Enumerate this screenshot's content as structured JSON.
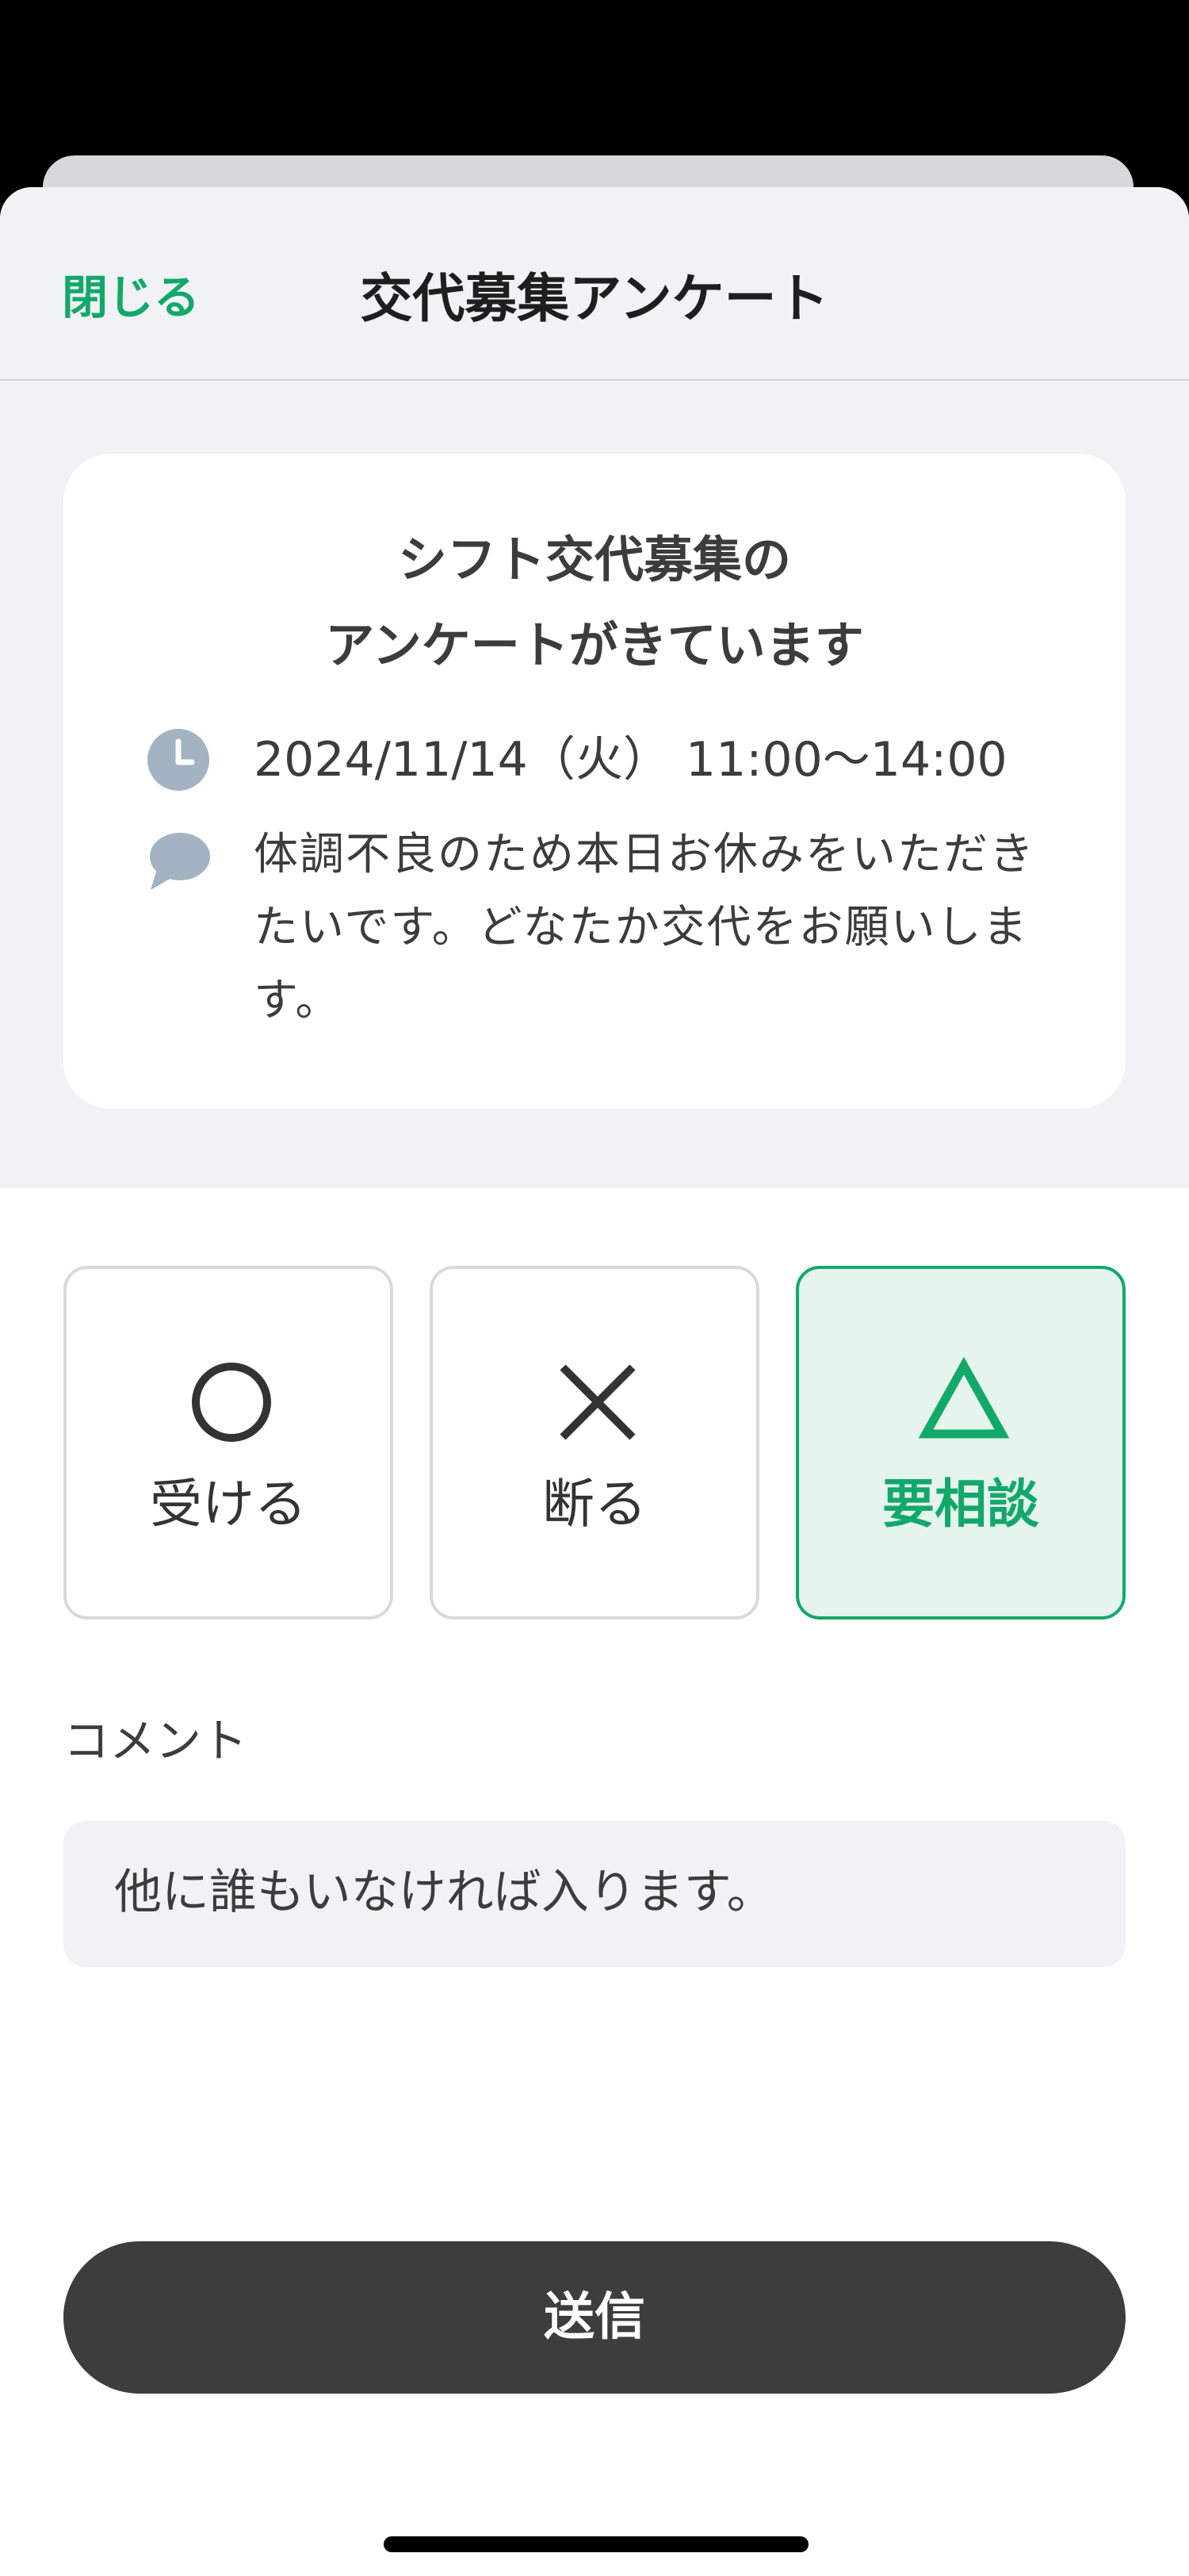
{
  "nav": {
    "close_label": "閉じる",
    "title": "交代募集アンケート"
  },
  "card": {
    "title_line1": "シフト交代募集の",
    "title_line2": "アンケートがきています",
    "date": "2024/11/14（火）  11:00〜14:00",
    "message": "体調不良のため本日お休みをいただきたいです。どなたか交代をお願いします。",
    "icons": {
      "date": "clock-icon",
      "message": "speech-bubble-icon"
    }
  },
  "choices": [
    {
      "symbol": "circle",
      "label": "受ける",
      "selected": false
    },
    {
      "symbol": "cross",
      "label": "断る",
      "selected": false
    },
    {
      "symbol": "triangle",
      "label": "要相談",
      "selected": true
    }
  ],
  "comment": {
    "label": "コメント",
    "value": "他に誰もいなければ入ります。"
  },
  "submit": {
    "label": "送信"
  },
  "colors": {
    "accent": "#12a86a",
    "accent_bg": "#e5f5ee",
    "button": "#3d3d3d",
    "icon": "#a3b3c1"
  }
}
